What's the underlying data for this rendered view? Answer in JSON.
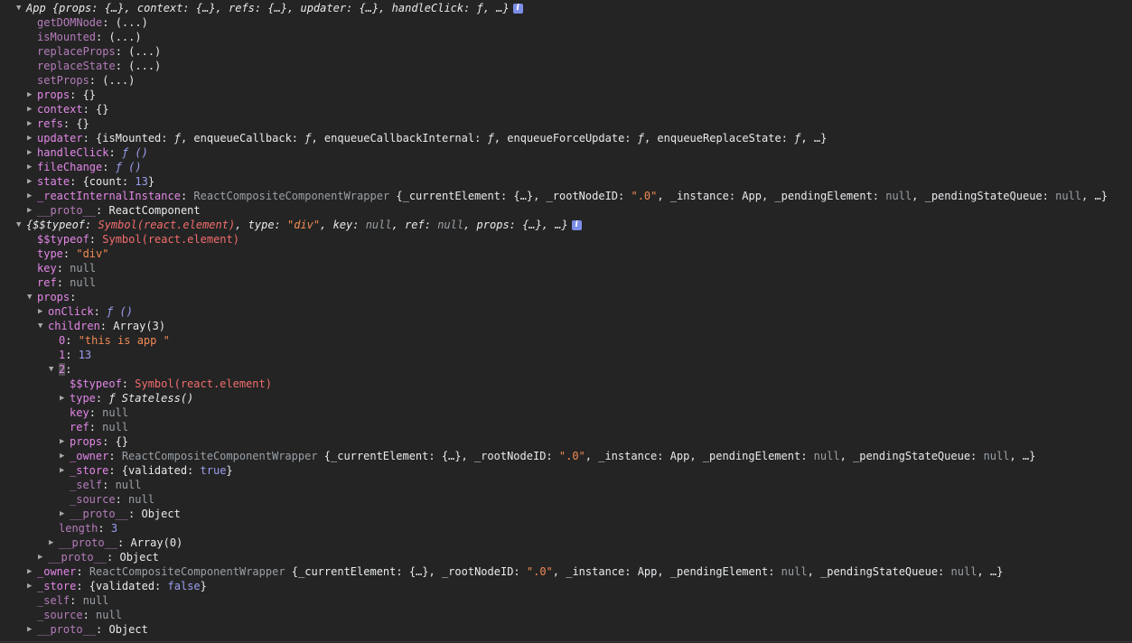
{
  "lines": [
    {
      "indent": 18,
      "tw": "▼",
      "parts": [
        {
          "t": "App ",
          "c": "it"
        },
        {
          "t": "{",
          "c": "it"
        },
        {
          "t": "props",
          "c": "it"
        },
        {
          "t": ": {…}, ",
          "c": "it"
        },
        {
          "t": "context",
          "c": "it"
        },
        {
          "t": ": {…}, ",
          "c": "it"
        },
        {
          "t": "refs",
          "c": "it"
        },
        {
          "t": ": {…}, ",
          "c": "it"
        },
        {
          "t": "updater",
          "c": "it"
        },
        {
          "t": ": {…}, ",
          "c": "it"
        },
        {
          "t": "handleClick",
          "c": "it"
        },
        {
          "t": ": ",
          "c": "it"
        },
        {
          "t": "ƒ",
          "c": "it"
        },
        {
          "t": ", …}",
          "c": "it"
        }
      ],
      "info": "i"
    },
    {
      "indent": 30,
      "tw": "",
      "parts": [
        {
          "t": "getDOMNode",
          "c": "kd"
        },
        {
          "t": ": (...)",
          "c": "v"
        }
      ]
    },
    {
      "indent": 30,
      "tw": "",
      "parts": [
        {
          "t": "isMounted",
          "c": "kd"
        },
        {
          "t": ": (...)",
          "c": "v"
        }
      ]
    },
    {
      "indent": 30,
      "tw": "",
      "parts": [
        {
          "t": "replaceProps",
          "c": "kd"
        },
        {
          "t": ": (...)",
          "c": "v"
        }
      ]
    },
    {
      "indent": 30,
      "tw": "",
      "parts": [
        {
          "t": "replaceState",
          "c": "kd"
        },
        {
          "t": ": (...)",
          "c": "v"
        }
      ]
    },
    {
      "indent": 30,
      "tw": "",
      "parts": [
        {
          "t": "setProps",
          "c": "kd"
        },
        {
          "t": ": (...)",
          "c": "v"
        }
      ]
    },
    {
      "indent": 30,
      "tw": "▶",
      "parts": [
        {
          "t": "props",
          "c": "k"
        },
        {
          "t": ": {}",
          "c": "v"
        }
      ]
    },
    {
      "indent": 30,
      "tw": "▶",
      "parts": [
        {
          "t": "context",
          "c": "k"
        },
        {
          "t": ": {}",
          "c": "v"
        }
      ]
    },
    {
      "indent": 30,
      "tw": "▶",
      "parts": [
        {
          "t": "refs",
          "c": "k"
        },
        {
          "t": ": {}",
          "c": "v"
        }
      ]
    },
    {
      "indent": 30,
      "tw": "▶",
      "parts": [
        {
          "t": "updater",
          "c": "k"
        },
        {
          "t": ": {isMounted: ",
          "c": "v"
        },
        {
          "t": "ƒ",
          "c": "it"
        },
        {
          "t": ", enqueueCallback: ",
          "c": "v"
        },
        {
          "t": "ƒ",
          "c": "it"
        },
        {
          "t": ", enqueueCallbackInternal: ",
          "c": "v"
        },
        {
          "t": "ƒ",
          "c": "it"
        },
        {
          "t": ", enqueueForceUpdate: ",
          "c": "v"
        },
        {
          "t": "ƒ",
          "c": "it"
        },
        {
          "t": ", enqueueReplaceState: ",
          "c": "v"
        },
        {
          "t": "ƒ",
          "c": "it"
        },
        {
          "t": ", …}",
          "c": "v"
        }
      ]
    },
    {
      "indent": 30,
      "tw": "▶",
      "parts": [
        {
          "t": "handleClick",
          "c": "k"
        },
        {
          "t": ": ",
          "c": "v"
        },
        {
          "t": "ƒ ()",
          "c": "fn"
        }
      ]
    },
    {
      "indent": 30,
      "tw": "▶",
      "parts": [
        {
          "t": "fileChange",
          "c": "k"
        },
        {
          "t": ": ",
          "c": "v"
        },
        {
          "t": "ƒ ()",
          "c": "fn"
        }
      ]
    },
    {
      "indent": 30,
      "tw": "▶",
      "parts": [
        {
          "t": "state",
          "c": "k"
        },
        {
          "t": ": {count: ",
          "c": "v"
        },
        {
          "t": "13",
          "c": "n"
        },
        {
          "t": "}",
          "c": "v"
        }
      ]
    },
    {
      "indent": 30,
      "tw": "▶",
      "parts": [
        {
          "t": "_reactInternalInstance",
          "c": "k"
        },
        {
          "t": ": ",
          "c": "v"
        },
        {
          "t": "ReactCompositeComponentWrapper",
          "c": "nl"
        },
        {
          "t": " {_currentElement: {…}, _rootNodeID: ",
          "c": "v"
        },
        {
          "t": "\".0\"",
          "c": "s"
        },
        {
          "t": ", _instance: App, _pendingElement: ",
          "c": "v"
        },
        {
          "t": "null",
          "c": "nl"
        },
        {
          "t": ", _pendingStateQueue: ",
          "c": "v"
        },
        {
          "t": "null",
          "c": "nl"
        },
        {
          "t": ", …}",
          "c": "v"
        }
      ]
    },
    {
      "indent": 30,
      "tw": "▶",
      "parts": [
        {
          "t": "__proto__",
          "c": "kd"
        },
        {
          "t": ": ReactComponent",
          "c": "v"
        }
      ]
    },
    {
      "indent": 18,
      "tw": "▼",
      "parts": [
        {
          "t": "{",
          "c": "it"
        },
        {
          "t": "$$typeof",
          "c": "it"
        },
        {
          "t": ": ",
          "c": "it"
        },
        {
          "t": "Symbol(react.element)",
          "c": "sym it"
        },
        {
          "t": ", type: ",
          "c": "it"
        },
        {
          "t": "\"div\"",
          "c": "s it"
        },
        {
          "t": ", key: ",
          "c": "it"
        },
        {
          "t": "null",
          "c": "nl it"
        },
        {
          "t": ", ref: ",
          "c": "it"
        },
        {
          "t": "null",
          "c": "nl it"
        },
        {
          "t": ", props: {…}, …}",
          "c": "it"
        }
      ],
      "info": "i"
    },
    {
      "indent": 30,
      "tw": "",
      "parts": [
        {
          "t": "$$typeof",
          "c": "k"
        },
        {
          "t": ": ",
          "c": "v"
        },
        {
          "t": "Symbol(react.element)",
          "c": "sym"
        }
      ]
    },
    {
      "indent": 30,
      "tw": "",
      "parts": [
        {
          "t": "type",
          "c": "k"
        },
        {
          "t": ": ",
          "c": "v"
        },
        {
          "t": "\"div\"",
          "c": "s"
        }
      ]
    },
    {
      "indent": 30,
      "tw": "",
      "parts": [
        {
          "t": "key",
          "c": "k"
        },
        {
          "t": ": ",
          "c": "v"
        },
        {
          "t": "null",
          "c": "nl"
        }
      ]
    },
    {
      "indent": 30,
      "tw": "",
      "parts": [
        {
          "t": "ref",
          "c": "k"
        },
        {
          "t": ": ",
          "c": "v"
        },
        {
          "t": "null",
          "c": "nl"
        }
      ]
    },
    {
      "indent": 30,
      "tw": "▼",
      "parts": [
        {
          "t": "props",
          "c": "k"
        },
        {
          "t": ":",
          "c": "v"
        }
      ]
    },
    {
      "indent": 42,
      "tw": "▶",
      "parts": [
        {
          "t": "onClick",
          "c": "k"
        },
        {
          "t": ": ",
          "c": "v"
        },
        {
          "t": "ƒ ()",
          "c": "fn"
        }
      ]
    },
    {
      "indent": 42,
      "tw": "▼",
      "parts": [
        {
          "t": "children",
          "c": "k"
        },
        {
          "t": ": Array(3)",
          "c": "v"
        }
      ]
    },
    {
      "indent": 54,
      "tw": "",
      "parts": [
        {
          "t": "0",
          "c": "k"
        },
        {
          "t": ": ",
          "c": "v"
        },
        {
          "t": "\"this is app \"",
          "c": "s"
        }
      ]
    },
    {
      "indent": 54,
      "tw": "",
      "parts": [
        {
          "t": "1",
          "c": "k"
        },
        {
          "t": ": ",
          "c": "v"
        },
        {
          "t": "13",
          "c": "n"
        }
      ]
    },
    {
      "indent": 54,
      "tw": "▼",
      "parts": [
        {
          "t": "2",
          "c": "k hl"
        },
        {
          "t": ":",
          "c": "v"
        }
      ]
    },
    {
      "indent": 66,
      "tw": "",
      "parts": [
        {
          "t": "$$typeof",
          "c": "k"
        },
        {
          "t": ": ",
          "c": "v"
        },
        {
          "t": "Symbol(react.element)",
          "c": "sym"
        }
      ]
    },
    {
      "indent": 66,
      "tw": "▶",
      "parts": [
        {
          "t": "type",
          "c": "k"
        },
        {
          "t": ": ",
          "c": "v"
        },
        {
          "t": "ƒ Stateless()",
          "c": "it"
        }
      ]
    },
    {
      "indent": 66,
      "tw": "",
      "parts": [
        {
          "t": "key",
          "c": "k"
        },
        {
          "t": ": ",
          "c": "v"
        },
        {
          "t": "null",
          "c": "nl"
        }
      ]
    },
    {
      "indent": 66,
      "tw": "",
      "parts": [
        {
          "t": "ref",
          "c": "k"
        },
        {
          "t": ": ",
          "c": "v"
        },
        {
          "t": "null",
          "c": "nl"
        }
      ]
    },
    {
      "indent": 66,
      "tw": "▶",
      "parts": [
        {
          "t": "props",
          "c": "k"
        },
        {
          "t": ": {}",
          "c": "v"
        }
      ]
    },
    {
      "indent": 66,
      "tw": "▶",
      "parts": [
        {
          "t": "_owner",
          "c": "k"
        },
        {
          "t": ": ",
          "c": "v"
        },
        {
          "t": "ReactCompositeComponentWrapper",
          "c": "nl"
        },
        {
          "t": " {_currentElement: {…}, _rootNodeID: ",
          "c": "v"
        },
        {
          "t": "\".0\"",
          "c": "s"
        },
        {
          "t": ", _instance: App, _pendingElement: ",
          "c": "v"
        },
        {
          "t": "null",
          "c": "nl"
        },
        {
          "t": ", _pendingStateQueue: ",
          "c": "v"
        },
        {
          "t": "null",
          "c": "nl"
        },
        {
          "t": ", …}",
          "c": "v"
        }
      ]
    },
    {
      "indent": 66,
      "tw": "▶",
      "parts": [
        {
          "t": "_store",
          "c": "k"
        },
        {
          "t": ": {validated: ",
          "c": "v"
        },
        {
          "t": "true",
          "c": "n"
        },
        {
          "t": "}",
          "c": "v"
        }
      ]
    },
    {
      "indent": 66,
      "tw": "",
      "parts": [
        {
          "t": "_self",
          "c": "kd"
        },
        {
          "t": ": ",
          "c": "v"
        },
        {
          "t": "null",
          "c": "nl"
        }
      ]
    },
    {
      "indent": 66,
      "tw": "",
      "parts": [
        {
          "t": "_source",
          "c": "kd"
        },
        {
          "t": ": ",
          "c": "v"
        },
        {
          "t": "null",
          "c": "nl"
        }
      ]
    },
    {
      "indent": 66,
      "tw": "▶",
      "parts": [
        {
          "t": "__proto__",
          "c": "kd"
        },
        {
          "t": ": Object",
          "c": "v"
        }
      ]
    },
    {
      "indent": 54,
      "tw": "",
      "parts": [
        {
          "t": "length",
          "c": "kd"
        },
        {
          "t": ": ",
          "c": "v"
        },
        {
          "t": "3",
          "c": "n"
        }
      ]
    },
    {
      "indent": 54,
      "tw": "▶",
      "parts": [
        {
          "t": "__proto__",
          "c": "kd"
        },
        {
          "t": ": Array(0)",
          "c": "v"
        }
      ]
    },
    {
      "indent": 42,
      "tw": "▶",
      "parts": [
        {
          "t": "__proto__",
          "c": "kd"
        },
        {
          "t": ": Object",
          "c": "v"
        }
      ]
    },
    {
      "indent": 30,
      "tw": "▶",
      "parts": [
        {
          "t": "_owner",
          "c": "k"
        },
        {
          "t": ": ",
          "c": "v"
        },
        {
          "t": "ReactCompositeComponentWrapper",
          "c": "nl"
        },
        {
          "t": " {_currentElement: {…}, _rootNodeID: ",
          "c": "v"
        },
        {
          "t": "\".0\"",
          "c": "s"
        },
        {
          "t": ", _instance: App, _pendingElement: ",
          "c": "v"
        },
        {
          "t": "null",
          "c": "nl"
        },
        {
          "t": ", _pendingStateQueue: ",
          "c": "v"
        },
        {
          "t": "null",
          "c": "nl"
        },
        {
          "t": ", …}",
          "c": "v"
        }
      ]
    },
    {
      "indent": 30,
      "tw": "▶",
      "parts": [
        {
          "t": "_store",
          "c": "k"
        },
        {
          "t": ": {validated: ",
          "c": "v"
        },
        {
          "t": "false",
          "c": "n"
        },
        {
          "t": "}",
          "c": "v"
        }
      ]
    },
    {
      "indent": 30,
      "tw": "",
      "parts": [
        {
          "t": "_self",
          "c": "kd"
        },
        {
          "t": ": ",
          "c": "v"
        },
        {
          "t": "null",
          "c": "nl"
        }
      ]
    },
    {
      "indent": 30,
      "tw": "",
      "parts": [
        {
          "t": "_source",
          "c": "kd"
        },
        {
          "t": ": ",
          "c": "v"
        },
        {
          "t": "null",
          "c": "nl"
        }
      ]
    },
    {
      "indent": 30,
      "tw": "▶",
      "parts": [
        {
          "t": "__proto__",
          "c": "kd"
        },
        {
          "t": ": Object",
          "c": "v"
        }
      ]
    }
  ]
}
